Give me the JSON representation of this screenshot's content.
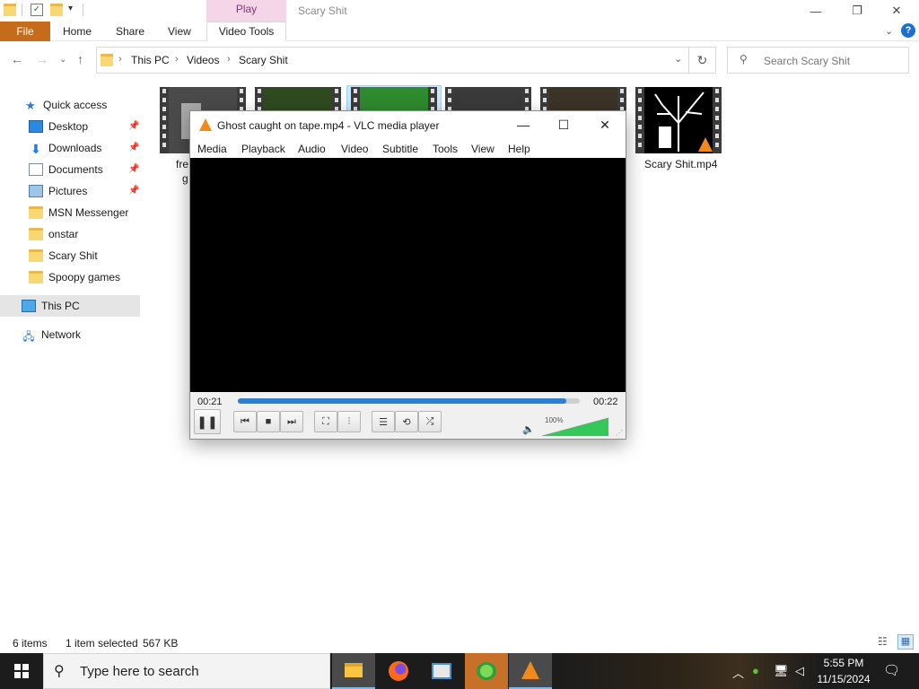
{
  "explorer": {
    "contextual_tab": "Play",
    "window_title": "Scary Shit",
    "ribbon_tabs": [
      "File",
      "Home",
      "Share",
      "View",
      "Video Tools"
    ],
    "path": [
      "This PC",
      "Videos",
      "Scary Shit"
    ],
    "search_placeholder": "Search Scary Shit",
    "sidebar": {
      "quick_access": "Quick access",
      "items": [
        {
          "label": "Desktop",
          "icon": "desktop-icon",
          "pinned": true
        },
        {
          "label": "Downloads",
          "icon": "downloads-icon",
          "pinned": true
        },
        {
          "label": "Documents",
          "icon": "documents-icon",
          "pinned": true
        },
        {
          "label": "Pictures",
          "icon": "pictures-icon",
          "pinned": true
        },
        {
          "label": "MSN Messenger",
          "icon": "folder-icon",
          "pinned": false
        },
        {
          "label": "onstar",
          "icon": "folder-icon",
          "pinned": false
        },
        {
          "label": "Scary Shit",
          "icon": "folder-icon",
          "pinned": false
        },
        {
          "label": "Spoopy games",
          "icon": "folder-icon",
          "pinned": false
        }
      ],
      "this_pc": "This PC",
      "network": "Network"
    },
    "files": [
      {
        "label": "fre g",
        "thumb": "#4a4a4a"
      },
      {
        "label": "",
        "thumb": "#2f4a1f"
      },
      {
        "label": "",
        "thumb": "#2e8b2e"
      },
      {
        "label": "",
        "thumb": "#3a3a3a"
      },
      {
        "label": "",
        "thumb": "#3d3428"
      },
      {
        "label": "Scary Shit.mp4",
        "thumb": "#000000"
      }
    ],
    "status": {
      "count": "6 items",
      "selected": "1 item selected",
      "size": "567 KB"
    }
  },
  "vlc": {
    "title": "Ghost caught on tape.mp4 - VLC media player",
    "menu": [
      "Media",
      "Playback",
      "Audio",
      "Video",
      "Subtitle",
      "Tools",
      "View",
      "Help"
    ],
    "elapsed": "00:21",
    "total": "00:22",
    "progress": 0.96,
    "volume_label": "100%",
    "volume": 1.0
  },
  "taskbar": {
    "search_placeholder": "Type here to search",
    "time": "5:55 PM",
    "date": "11/15/2024"
  },
  "colors": {
    "file_tab": "#c46c1b",
    "accent_blue": "#2f7fd1",
    "volume_green": "#34c759"
  }
}
